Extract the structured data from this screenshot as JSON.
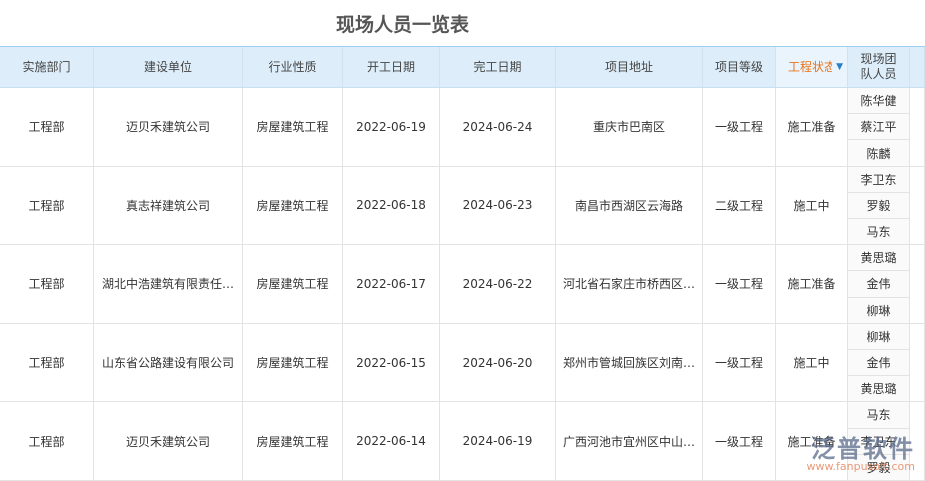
{
  "title": "现场人员一览表",
  "headers": [
    "实施部门",
    "建设单位",
    "行业性质",
    "开工日期",
    "完工日期",
    "项目地址",
    "项目等级",
    "工程状态",
    "现场团队人员"
  ],
  "rows": [
    {
      "dept": "工程部",
      "unit": "迈贝禾建筑公司",
      "nature": "房屋建筑工程",
      "start": "2022-06-19",
      "end": "2024-06-24",
      "address": "重庆市巴南区",
      "level": "一级工程",
      "status": "施工准备",
      "team": [
        "陈华健",
        "蔡江平",
        "陈麟"
      ]
    },
    {
      "dept": "工程部",
      "unit": "真志祥建筑公司",
      "nature": "房屋建筑工程",
      "start": "2022-06-18",
      "end": "2024-06-23",
      "address": "南昌市西湖区云海路",
      "level": "二级工程",
      "status": "施工中",
      "team": [
        "李卫东",
        "罗毅",
        "马东"
      ]
    },
    {
      "dept": "工程部",
      "unit": "湖北中浩建筑有限责任…",
      "nature": "房屋建筑工程",
      "start": "2022-06-17",
      "end": "2024-06-22",
      "address": "河北省石家庄市桥西区…",
      "level": "一级工程",
      "status": "施工准备",
      "team": [
        "黄思璐",
        "金伟",
        "柳琳"
      ]
    },
    {
      "dept": "工程部",
      "unit": "山东省公路建设有限公司",
      "nature": "房屋建筑工程",
      "start": "2022-06-15",
      "end": "2024-06-20",
      "address": "郑州市管城回族区刘南…",
      "level": "一级工程",
      "status": "施工中",
      "team": [
        "柳琳",
        "金伟",
        "黄思璐"
      ]
    },
    {
      "dept": "工程部",
      "unit": "迈贝禾建筑公司",
      "nature": "房屋建筑工程",
      "start": "2022-06-14",
      "end": "2024-06-19",
      "address": "广西河池市宜州区中山…",
      "level": "一级工程",
      "status": "施工准备",
      "team": [
        "马东",
        "李卫东",
        "罗毅"
      ]
    }
  ],
  "watermark": {
    "name": "泛普软件",
    "url": "www.fanpusoft.com"
  }
}
